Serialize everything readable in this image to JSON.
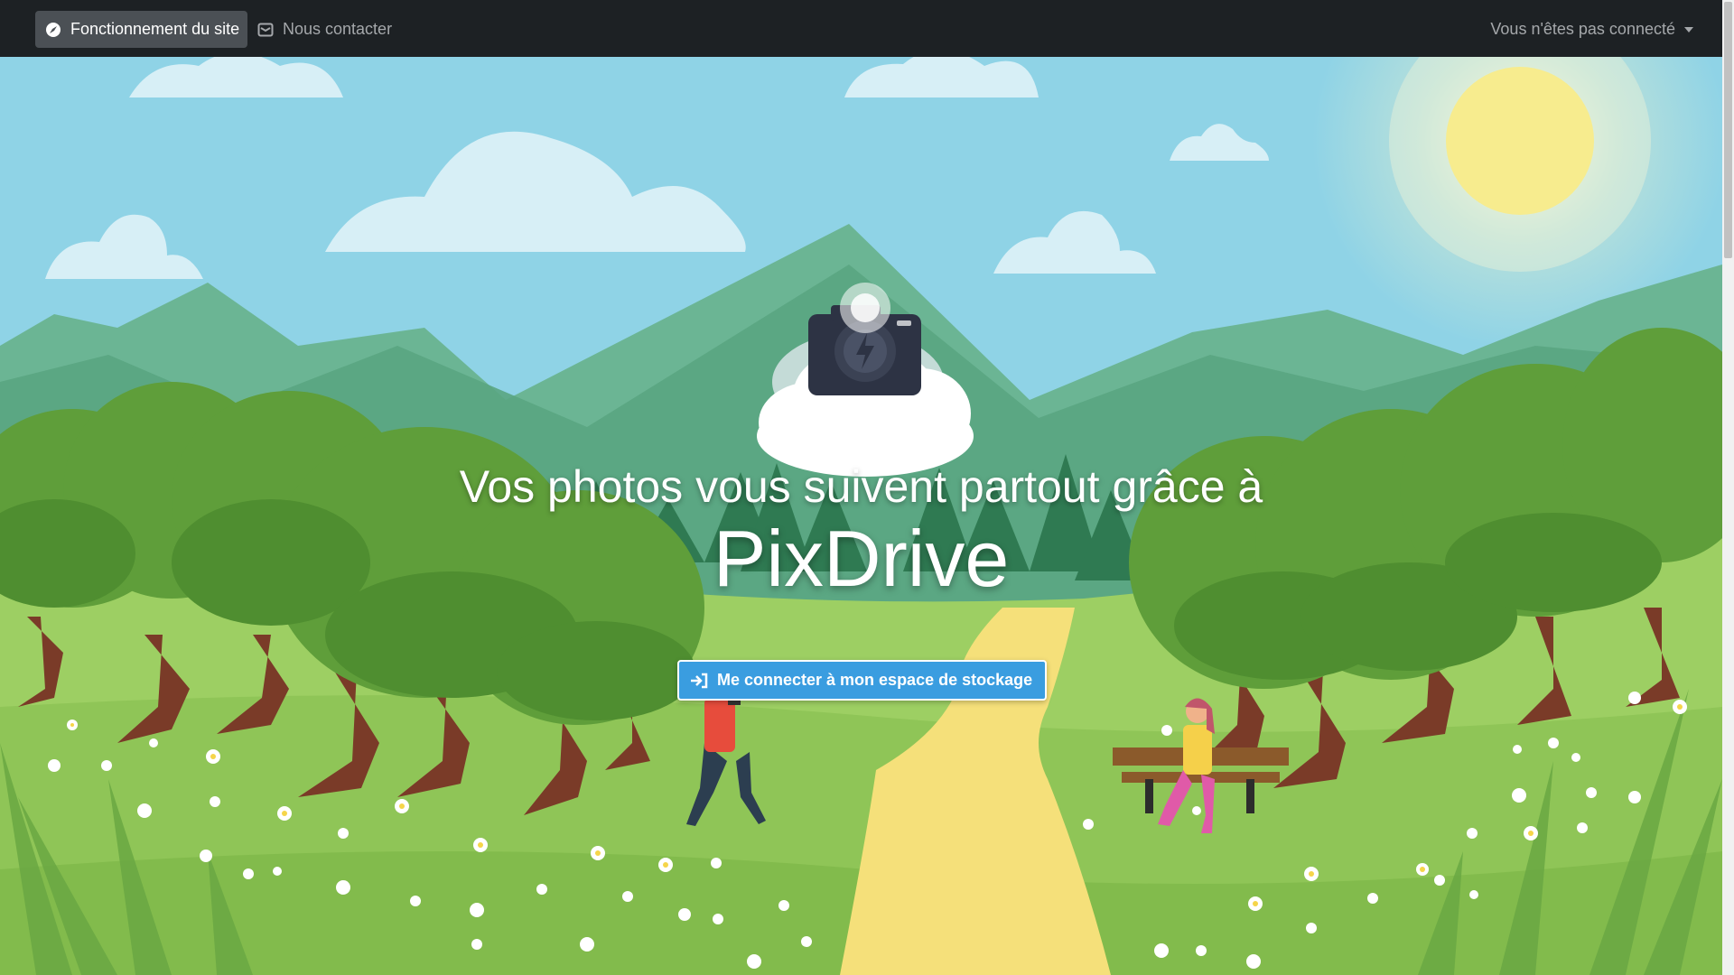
{
  "navbar": {
    "how_it_works": {
      "label": "Fonctionnement du site",
      "icon": "compass-icon"
    },
    "contact": {
      "label": "Nous contacter",
      "icon": "envelope-icon"
    },
    "user_menu": {
      "label": "Vous n'êtes pas connecté",
      "icon": "caret-down-icon"
    }
  },
  "hero": {
    "tagline": "Vos photos vous suivent partout grâce à",
    "brand": "PixDrive",
    "cta": {
      "label": "Me connecter à mon espace de stockage",
      "icon": "sign-in-icon"
    }
  },
  "colors": {
    "navbar_bg": "#1d2124",
    "nav_active_bg": "#4b5055",
    "cta_bg": "#3a9de0",
    "sky": "#8fd3e6",
    "path": "#f5e07a"
  }
}
